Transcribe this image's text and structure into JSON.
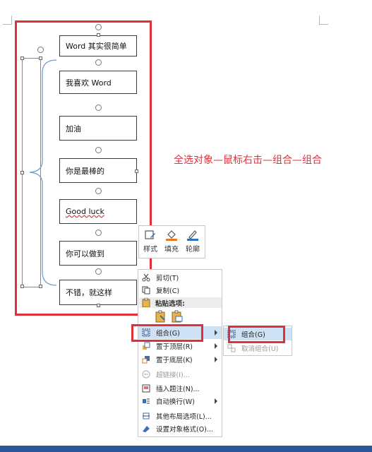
{
  "document": {
    "text_boxes": [
      "Word 其实很简单",
      "我喜欢 Word",
      "加油",
      "你是最棒的",
      "Good   luck",
      "你可以做到",
      "不错，就这样"
    ]
  },
  "annotation": "全选对象—鼠标右击—组合—组合",
  "mini_toolbar": {
    "style_label": "样式",
    "fill_label": "填充",
    "outline_label": "轮廓"
  },
  "context_menu": {
    "cut": "剪切(T)",
    "copy": "复制(C)",
    "paste_options": "粘贴选项:",
    "group": "组合(G)",
    "bring_to_front": "置于顶层(R)",
    "send_to_back": "置于底层(K)",
    "hyperlink": "超链接(I)...",
    "insert_caption": "插入题注(N)...",
    "wrap_text": "自动换行(W)",
    "more_layout": "其他布局选项(L)...",
    "format_object": "设置对象格式(O)..."
  },
  "group_submenu": {
    "group": "组合(G)",
    "ungroup": "取消组合(U)"
  },
  "colors": {
    "red_annotation": "#e0303a",
    "menu_highlight": "#cfe1f5",
    "status_bar": "#2b579a",
    "fill_orange": "#e8761b",
    "outline_blue": "#2f6fc0"
  }
}
